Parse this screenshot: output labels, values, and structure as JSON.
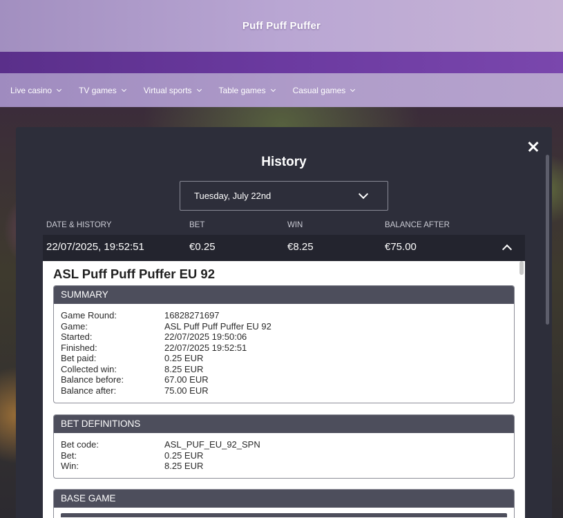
{
  "header": {
    "game_title": "Puff Puff Puffer"
  },
  "nav": {
    "items": [
      {
        "label": "Live casino"
      },
      {
        "label": "TV games"
      },
      {
        "label": "Virtual sports"
      },
      {
        "label": "Table games"
      },
      {
        "label": "Casual games"
      }
    ]
  },
  "modal": {
    "title": "History",
    "date_select": {
      "value": "Tuesday, July 22nd"
    },
    "columns": {
      "date": "DATE & HISTORY",
      "bet": "BET",
      "win": "WIN",
      "balance": "BALANCE AFTER"
    },
    "row": {
      "date": "22/07/2025, 19:52:51",
      "bet": "€0.25",
      "win": "€8.25",
      "balance": "€75.00"
    },
    "details": {
      "title": "ASL Puff Puff Puffer EU 92",
      "summary": {
        "heading": "SUMMARY",
        "items": [
          {
            "key": "Game Round:",
            "value": "16828271697"
          },
          {
            "key": "Game:",
            "value": "ASL Puff Puff Puffer EU 92"
          },
          {
            "key": "Started:",
            "value": "22/07/2025 19:50:06"
          },
          {
            "key": "Finished:",
            "value": "22/07/2025 19:52:51"
          },
          {
            "key": "Bet paid:",
            "value": "0.25 EUR"
          },
          {
            "key": "Collected win:",
            "value": "8.25 EUR"
          },
          {
            "key": "Balance before:",
            "value": "67.00 EUR"
          },
          {
            "key": "Balance after:",
            "value": "75.00 EUR"
          }
        ]
      },
      "bet_definitions": {
        "heading": "BET DEFINITIONS",
        "items": [
          {
            "key": "Bet code:",
            "value": "ASL_PUF_EU_92_SPN"
          },
          {
            "key": "Bet:",
            "value": "0.25 EUR"
          },
          {
            "key": "Win:",
            "value": "8.25 EUR"
          }
        ]
      },
      "base_game": {
        "heading": "BASE GAME"
      }
    }
  }
}
